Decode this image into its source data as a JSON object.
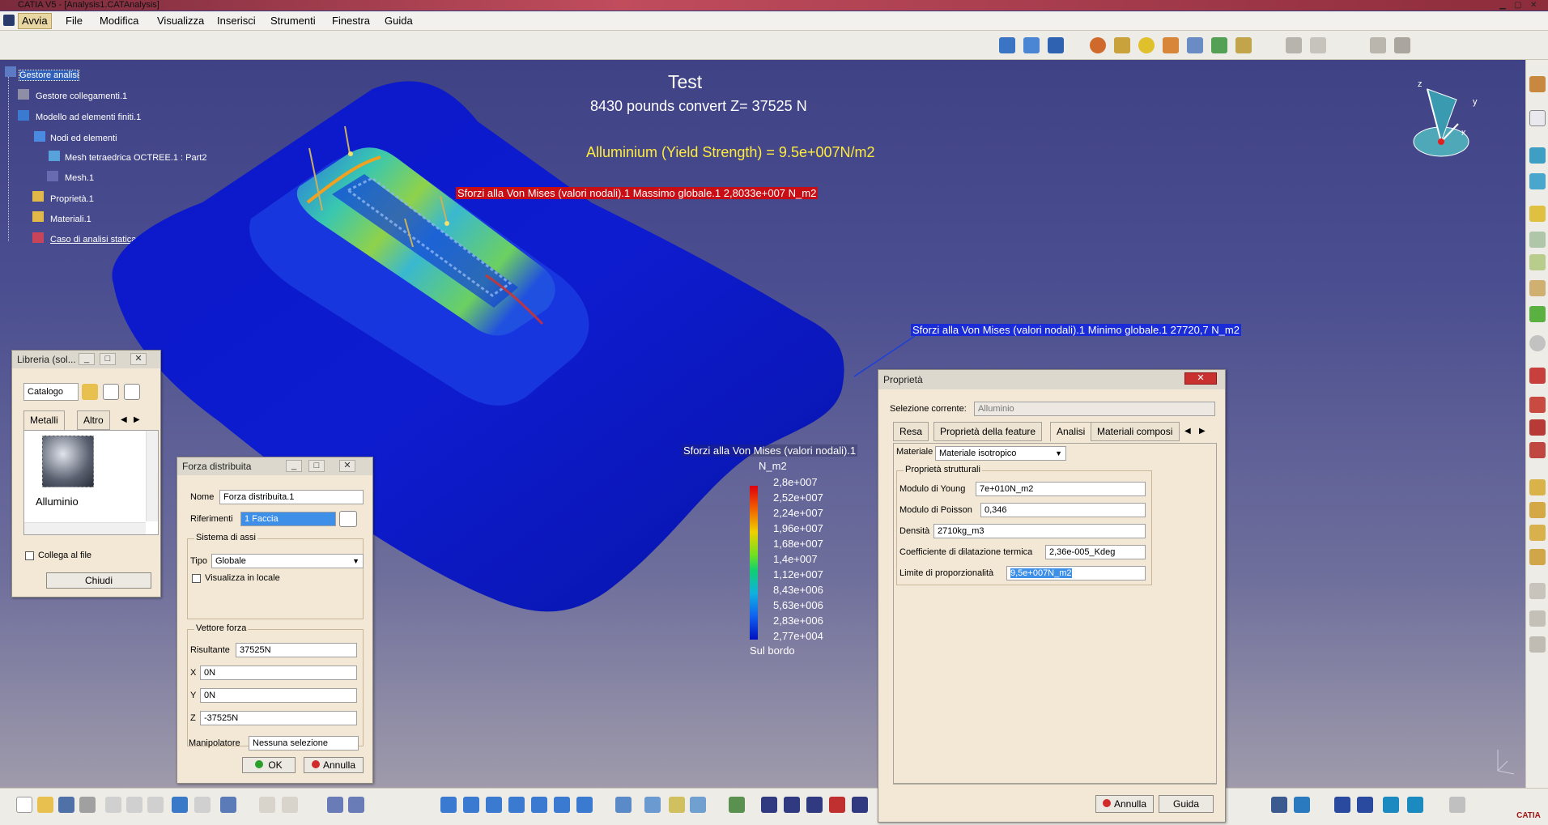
{
  "window": {
    "title": "CATIA V5 - [Analysis1.CATAnalysis]"
  },
  "menu": {
    "items": [
      "Avvia",
      "File",
      "Modifica",
      "Visualizza",
      "Inserisci",
      "Strumenti",
      "Finestra",
      "Guida"
    ]
  },
  "tree": {
    "items": [
      "Gestore analisi",
      "Gestore collegamenti.1",
      "Modello ad elementi finiti.1",
      "Nodi ed elementi",
      "Mesh tetraedrica OCTREE.1 : Part2",
      "Mesh.1",
      "Proprietà.1",
      "Materiali.1",
      "Caso di analisi statica"
    ]
  },
  "viewport": {
    "title": "Test",
    "subtitle": "8430 pounds convert Z= 37525 N",
    "yield": "Alluminium (Yield Strength) = 9.5e+007N/m2",
    "max_label": "Sforzi alla Von Mises (valori nodali).1  Massimo globale.1  2,8033e+007 N_m2",
    "min_label": "Sforzi alla Von Mises (valori nodali).1  Minimo globale.1  27720,7 N_m2"
  },
  "legend": {
    "title": "Sforzi alla Von Mises (valori nodali).1",
    "unit": "N_m2",
    "values": [
      "2,8e+007",
      "2,52e+007",
      "2,24e+007",
      "1,96e+007",
      "1,68e+007",
      "1,4e+007",
      "1,12e+007",
      "8,43e+006",
      "5,63e+006",
      "2,83e+006",
      "2,77e+004"
    ],
    "footer": "Sul bordo"
  },
  "library": {
    "title": "Libreria (sol...",
    "catalog": "Catalogo",
    "tabs": [
      "Metalli",
      "Altro"
    ],
    "material": "Alluminio",
    "link_label": "Collega al file",
    "close": "Chiudi"
  },
  "force": {
    "title": "Forza distribuita",
    "name_label": "Nome",
    "name": "Forza distribuita.1",
    "ref_label": "Riferimenti",
    "ref": "1 Faccia",
    "axes_group": "Sistema di assi",
    "type_label": "Tipo",
    "type": "Globale",
    "local_label": "Visualizza in locale",
    "vector_group": "Vettore forza",
    "res_label": "Risultante",
    "res": "37525N",
    "x_label": "X",
    "x": "0N",
    "y_label": "Y",
    "y": "0N",
    "z_label": "Z",
    "z": "-37525N",
    "manip_label": "Manipolatore",
    "manip": "Nessuna selezione",
    "ok": "OK",
    "cancel": "Annulla"
  },
  "props": {
    "title": "Proprietà",
    "sel_label": "Selezione corrente:",
    "sel": "Alluminio",
    "tabs": [
      "Resa",
      "Proprietà della feature",
      "Analisi",
      "Materiali composi"
    ],
    "mat_label": "Materiale",
    "mat": "Materiale isotropico",
    "struct_group": "Proprietà strutturali",
    "young_label": "Modulo di Young",
    "young": "7e+010N_m2",
    "poisson_label": "Modulo di Poisson",
    "poisson": "0,346",
    "density_label": "Densità",
    "density": "2710kg_m3",
    "thermal_label": "Coefficiente di dilatazione termica",
    "thermal": "2,36e-005_Kdeg",
    "limit_label": "Limite di proporzionalità",
    "limit": "9,5e+007N_m2",
    "cancel": "Annulla",
    "help": "Guida"
  },
  "compass": {
    "x": "x",
    "y": "y",
    "z": "z"
  }
}
